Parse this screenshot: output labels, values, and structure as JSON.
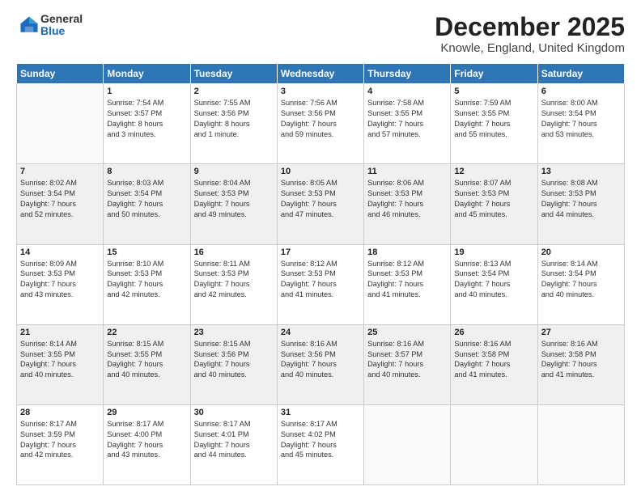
{
  "logo": {
    "general": "General",
    "blue": "Blue"
  },
  "title": "December 2025",
  "location": "Knowle, England, United Kingdom",
  "weekdays": [
    "Sunday",
    "Monday",
    "Tuesday",
    "Wednesday",
    "Thursday",
    "Friday",
    "Saturday"
  ],
  "weeks": [
    [
      {
        "day": "",
        "info": ""
      },
      {
        "day": "1",
        "info": "Sunrise: 7:54 AM\nSunset: 3:57 PM\nDaylight: 8 hours\nand 3 minutes."
      },
      {
        "day": "2",
        "info": "Sunrise: 7:55 AM\nSunset: 3:56 PM\nDaylight: 8 hours\nand 1 minute."
      },
      {
        "day": "3",
        "info": "Sunrise: 7:56 AM\nSunset: 3:56 PM\nDaylight: 7 hours\nand 59 minutes."
      },
      {
        "day": "4",
        "info": "Sunrise: 7:58 AM\nSunset: 3:55 PM\nDaylight: 7 hours\nand 57 minutes."
      },
      {
        "day": "5",
        "info": "Sunrise: 7:59 AM\nSunset: 3:55 PM\nDaylight: 7 hours\nand 55 minutes."
      },
      {
        "day": "6",
        "info": "Sunrise: 8:00 AM\nSunset: 3:54 PM\nDaylight: 7 hours\nand 53 minutes."
      }
    ],
    [
      {
        "day": "7",
        "info": "Sunrise: 8:02 AM\nSunset: 3:54 PM\nDaylight: 7 hours\nand 52 minutes."
      },
      {
        "day": "8",
        "info": "Sunrise: 8:03 AM\nSunset: 3:54 PM\nDaylight: 7 hours\nand 50 minutes."
      },
      {
        "day": "9",
        "info": "Sunrise: 8:04 AM\nSunset: 3:53 PM\nDaylight: 7 hours\nand 49 minutes."
      },
      {
        "day": "10",
        "info": "Sunrise: 8:05 AM\nSunset: 3:53 PM\nDaylight: 7 hours\nand 47 minutes."
      },
      {
        "day": "11",
        "info": "Sunrise: 8:06 AM\nSunset: 3:53 PM\nDaylight: 7 hours\nand 46 minutes."
      },
      {
        "day": "12",
        "info": "Sunrise: 8:07 AM\nSunset: 3:53 PM\nDaylight: 7 hours\nand 45 minutes."
      },
      {
        "day": "13",
        "info": "Sunrise: 8:08 AM\nSunset: 3:53 PM\nDaylight: 7 hours\nand 44 minutes."
      }
    ],
    [
      {
        "day": "14",
        "info": "Sunrise: 8:09 AM\nSunset: 3:53 PM\nDaylight: 7 hours\nand 43 minutes."
      },
      {
        "day": "15",
        "info": "Sunrise: 8:10 AM\nSunset: 3:53 PM\nDaylight: 7 hours\nand 42 minutes."
      },
      {
        "day": "16",
        "info": "Sunrise: 8:11 AM\nSunset: 3:53 PM\nDaylight: 7 hours\nand 42 minutes."
      },
      {
        "day": "17",
        "info": "Sunrise: 8:12 AM\nSunset: 3:53 PM\nDaylight: 7 hours\nand 41 minutes."
      },
      {
        "day": "18",
        "info": "Sunrise: 8:12 AM\nSunset: 3:53 PM\nDaylight: 7 hours\nand 41 minutes."
      },
      {
        "day": "19",
        "info": "Sunrise: 8:13 AM\nSunset: 3:54 PM\nDaylight: 7 hours\nand 40 minutes."
      },
      {
        "day": "20",
        "info": "Sunrise: 8:14 AM\nSunset: 3:54 PM\nDaylight: 7 hours\nand 40 minutes."
      }
    ],
    [
      {
        "day": "21",
        "info": "Sunrise: 8:14 AM\nSunset: 3:55 PM\nDaylight: 7 hours\nand 40 minutes."
      },
      {
        "day": "22",
        "info": "Sunrise: 8:15 AM\nSunset: 3:55 PM\nDaylight: 7 hours\nand 40 minutes."
      },
      {
        "day": "23",
        "info": "Sunrise: 8:15 AM\nSunset: 3:56 PM\nDaylight: 7 hours\nand 40 minutes."
      },
      {
        "day": "24",
        "info": "Sunrise: 8:16 AM\nSunset: 3:56 PM\nDaylight: 7 hours\nand 40 minutes."
      },
      {
        "day": "25",
        "info": "Sunrise: 8:16 AM\nSunset: 3:57 PM\nDaylight: 7 hours\nand 40 minutes."
      },
      {
        "day": "26",
        "info": "Sunrise: 8:16 AM\nSunset: 3:58 PM\nDaylight: 7 hours\nand 41 minutes."
      },
      {
        "day": "27",
        "info": "Sunrise: 8:16 AM\nSunset: 3:58 PM\nDaylight: 7 hours\nand 41 minutes."
      }
    ],
    [
      {
        "day": "28",
        "info": "Sunrise: 8:17 AM\nSunset: 3:59 PM\nDaylight: 7 hours\nand 42 minutes."
      },
      {
        "day": "29",
        "info": "Sunrise: 8:17 AM\nSunset: 4:00 PM\nDaylight: 7 hours\nand 43 minutes."
      },
      {
        "day": "30",
        "info": "Sunrise: 8:17 AM\nSunset: 4:01 PM\nDaylight: 7 hours\nand 44 minutes."
      },
      {
        "day": "31",
        "info": "Sunrise: 8:17 AM\nSunset: 4:02 PM\nDaylight: 7 hours\nand 45 minutes."
      },
      {
        "day": "",
        "info": ""
      },
      {
        "day": "",
        "info": ""
      },
      {
        "day": "",
        "info": ""
      }
    ]
  ]
}
